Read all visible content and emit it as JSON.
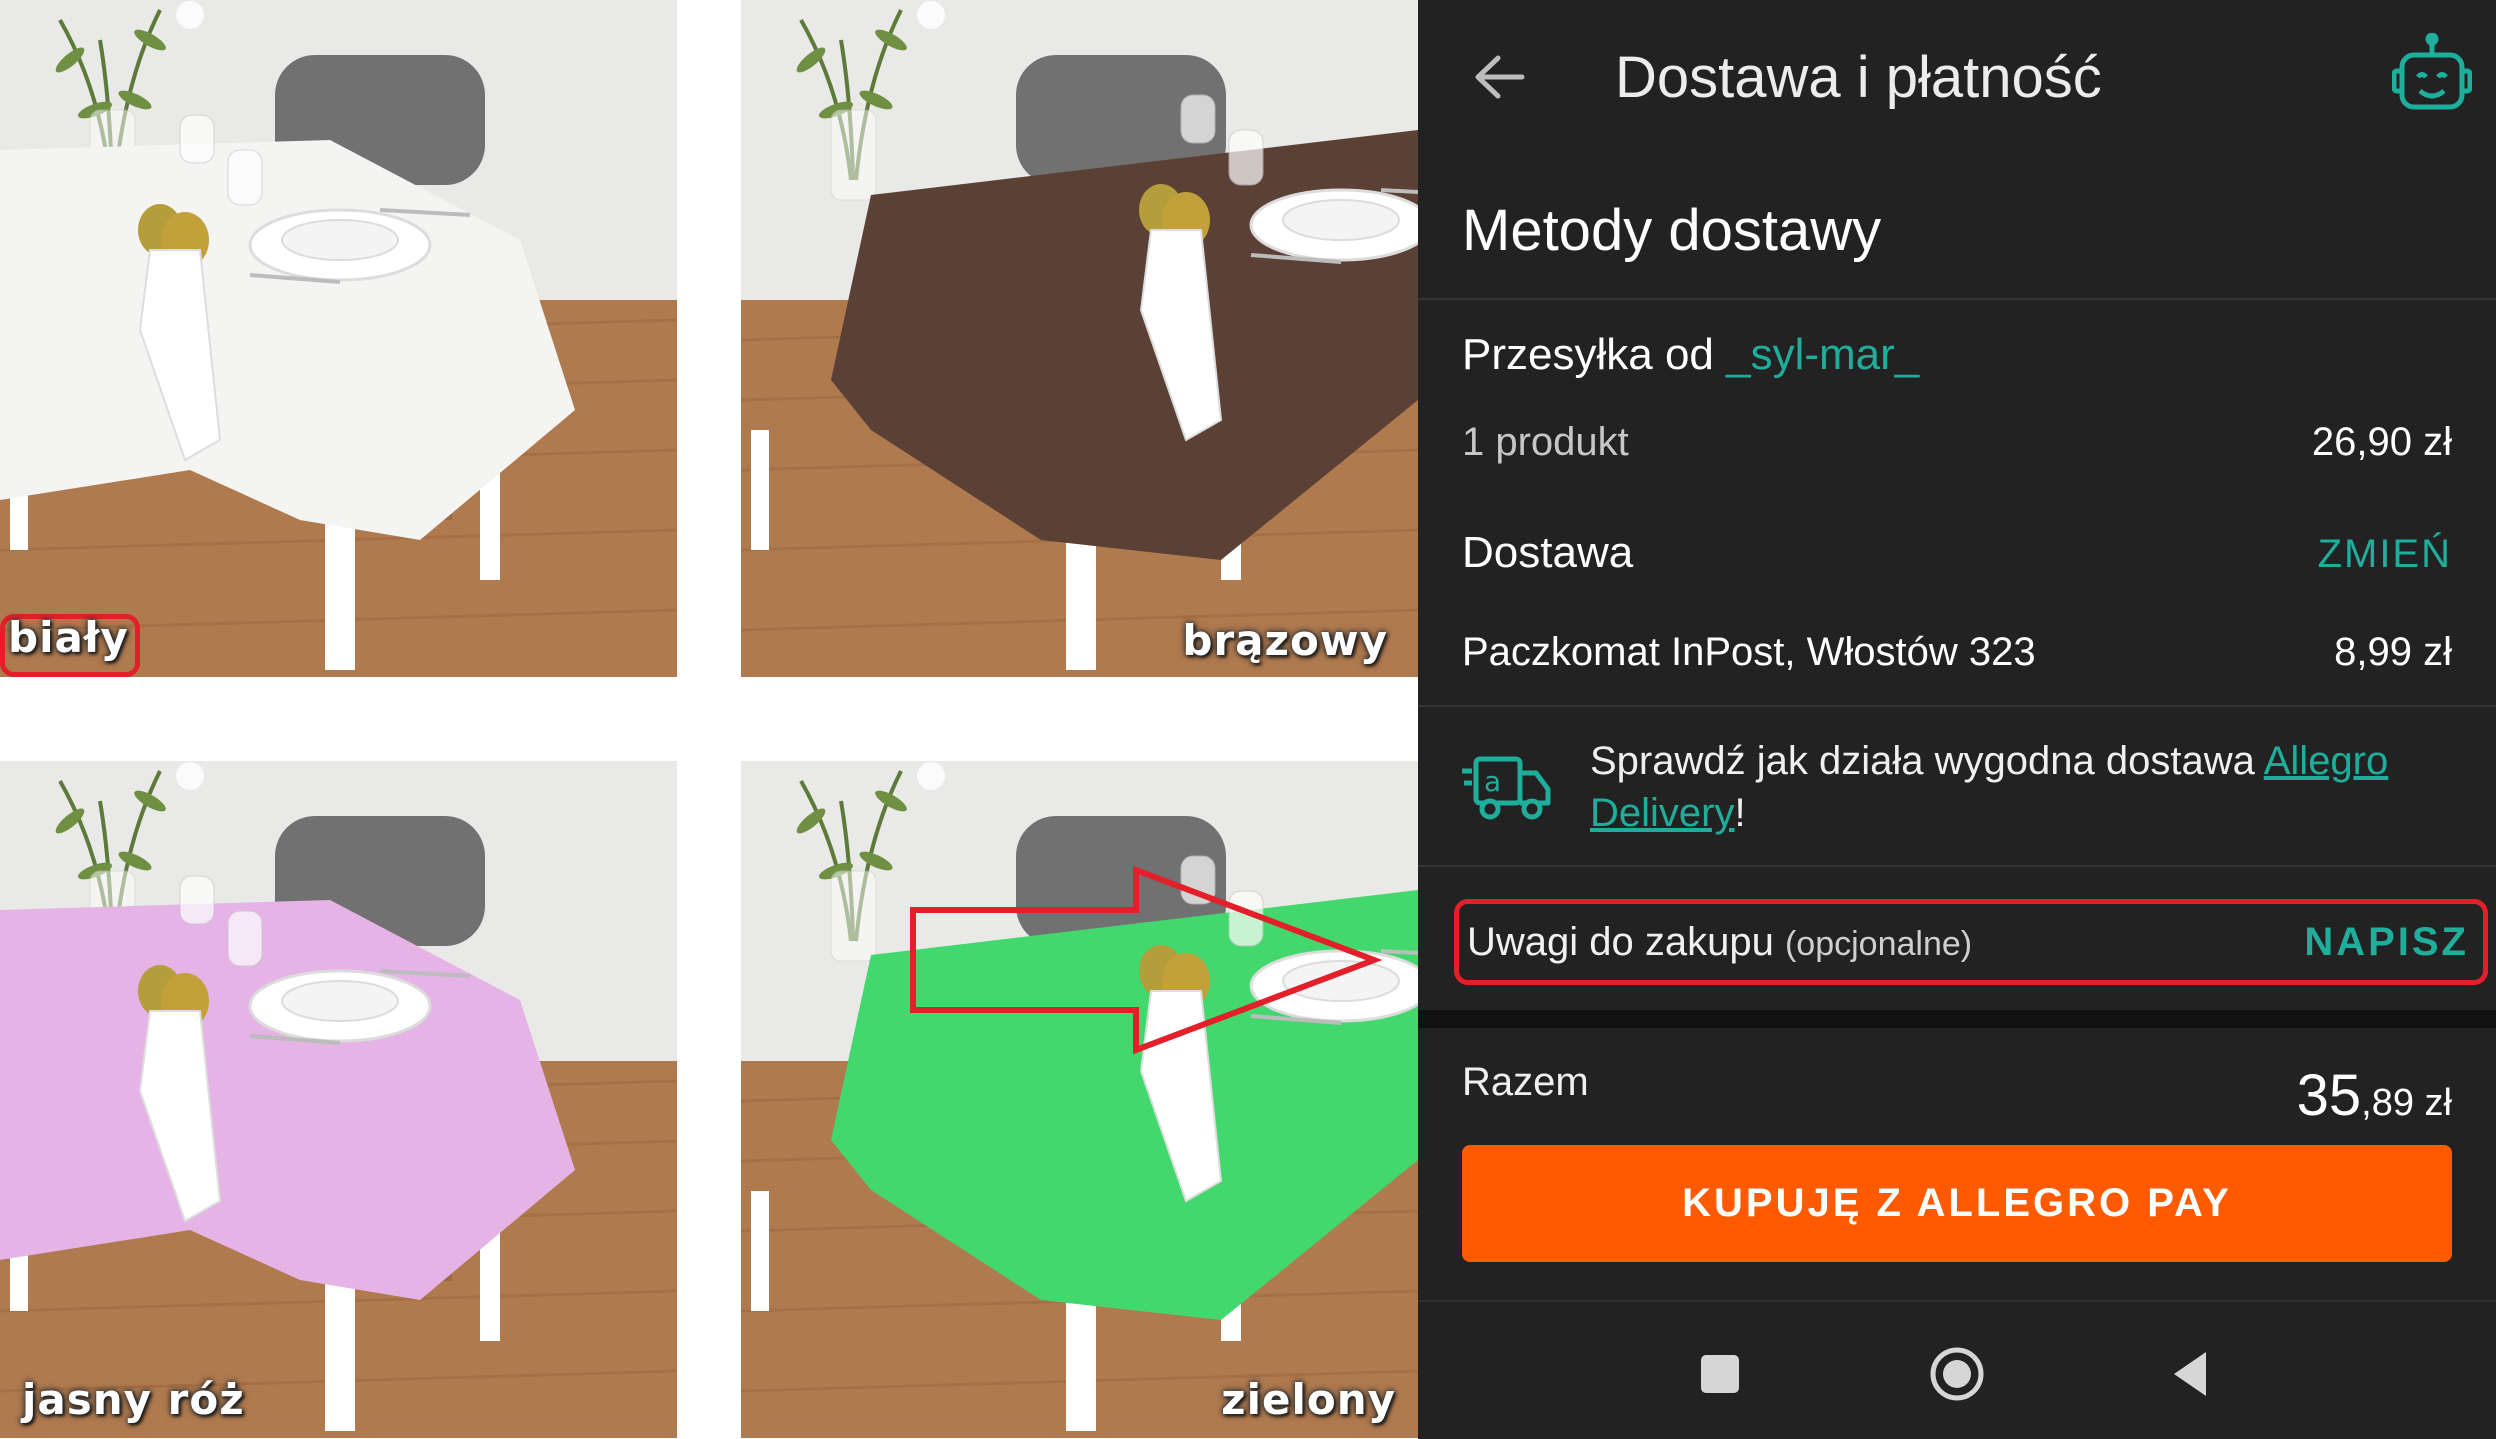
{
  "tiles": [
    {
      "label": "biały",
      "cloth_color": "#f4f4f2"
    },
    {
      "label": "brązowy",
      "cloth_color": "#5a4035"
    },
    {
      "label": "jasny róż",
      "cloth_color": "#e6b3e6"
    },
    {
      "label": "zielony",
      "cloth_color": "#43d86e"
    }
  ],
  "appbar": {
    "title": "Dostawa i płatność",
    "back_icon": "arrow-left-icon",
    "assistant_icon": "robot-icon"
  },
  "section_title": "Metody dostawy",
  "shipment": {
    "prefix": "Przesyłka od ",
    "seller": "_syl-mar_",
    "product_count": "1 produkt",
    "product_price": "26,90 zł",
    "delivery_label": "Dostawa",
    "change_label": "ZMIEŃ",
    "method": "Paczkomat InPost, Włostów 323",
    "method_price": "8,99 zł"
  },
  "promo": {
    "icon": "delivery-truck-icon",
    "text": "Sprawdź jak działa wygodna dostawa ",
    "link": "Allegro Delivery",
    "suffix": "!"
  },
  "notes": {
    "label": "Uwagi do zakupu",
    "optional": "(opcjonalne)",
    "action": "NAPISZ"
  },
  "total": {
    "label": "Razem",
    "int": "35",
    "dec": ",89",
    "currency": " zł"
  },
  "buy_button": "KUPUJĘ Z ALLEGRO PAY",
  "colors": {
    "accent": "#1fae9c",
    "buy": "#ff5a00",
    "highlight": "#e3202a",
    "background": "#222222"
  },
  "nav": {
    "recent_icon": "square-icon",
    "home_icon": "circle-home-icon",
    "back_icon": "triangle-back-icon"
  }
}
